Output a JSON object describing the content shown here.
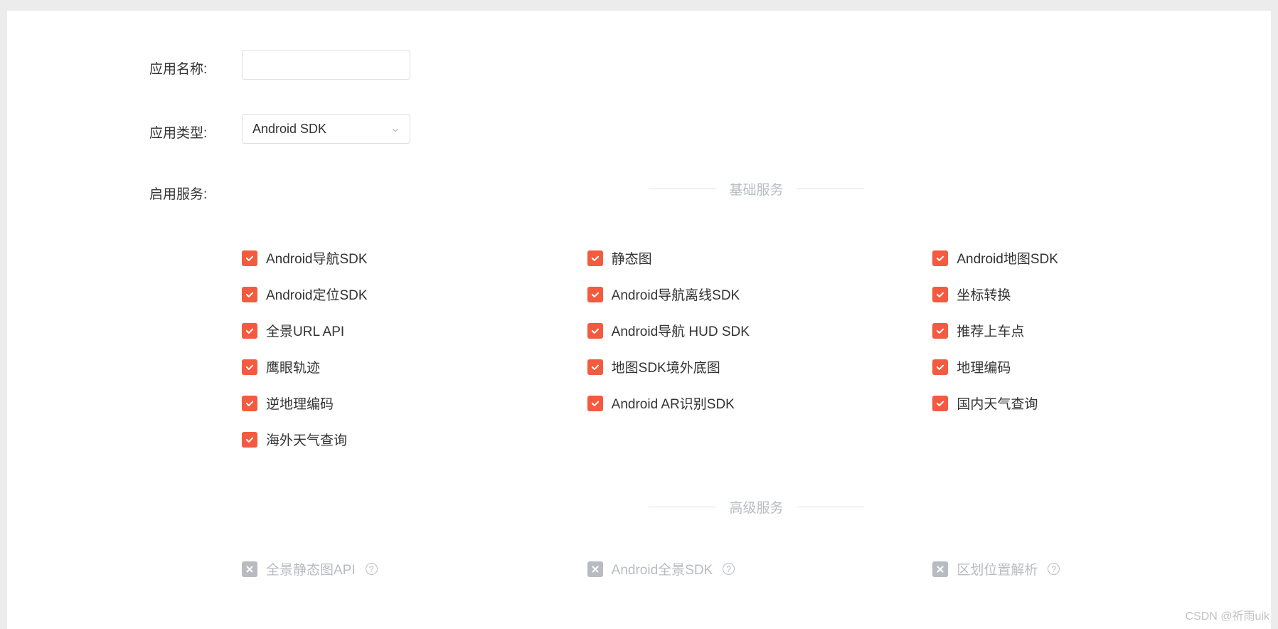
{
  "form": {
    "app_name_label": "应用名称:",
    "app_name_value": "",
    "app_type_label": "应用类型:",
    "app_type_value": "Android SDK",
    "services_label": "启用服务:"
  },
  "sections": {
    "basic": {
      "title": "基础服务",
      "items": [
        {
          "label": "Android导航SDK",
          "checked": true
        },
        {
          "label": "静态图",
          "checked": true
        },
        {
          "label": "Android地图SDK",
          "checked": true
        },
        {
          "label": "Android定位SDK",
          "checked": true
        },
        {
          "label": "Android导航离线SDK",
          "checked": true
        },
        {
          "label": "坐标转换",
          "checked": true
        },
        {
          "label": "全景URL API",
          "checked": true
        },
        {
          "label": "Android导航 HUD SDK",
          "checked": true
        },
        {
          "label": "推荐上车点",
          "checked": true
        },
        {
          "label": "鹰眼轨迹",
          "checked": true
        },
        {
          "label": "地图SDK境外底图",
          "checked": true
        },
        {
          "label": "地理编码",
          "checked": true
        },
        {
          "label": "逆地理编码",
          "checked": true
        },
        {
          "label": "Android AR识别SDK",
          "checked": true
        },
        {
          "label": "国内天气查询",
          "checked": true
        },
        {
          "label": "海外天气查询",
          "checked": true
        }
      ]
    },
    "advanced": {
      "title": "高级服务",
      "items": [
        {
          "label": "全景静态图API",
          "disabled": true,
          "help": true
        },
        {
          "label": "Android全景SDK",
          "disabled": true,
          "help": true
        },
        {
          "label": "区划位置解析",
          "disabled": true,
          "help": true
        }
      ]
    }
  },
  "watermark": "CSDN @祈雨uik"
}
